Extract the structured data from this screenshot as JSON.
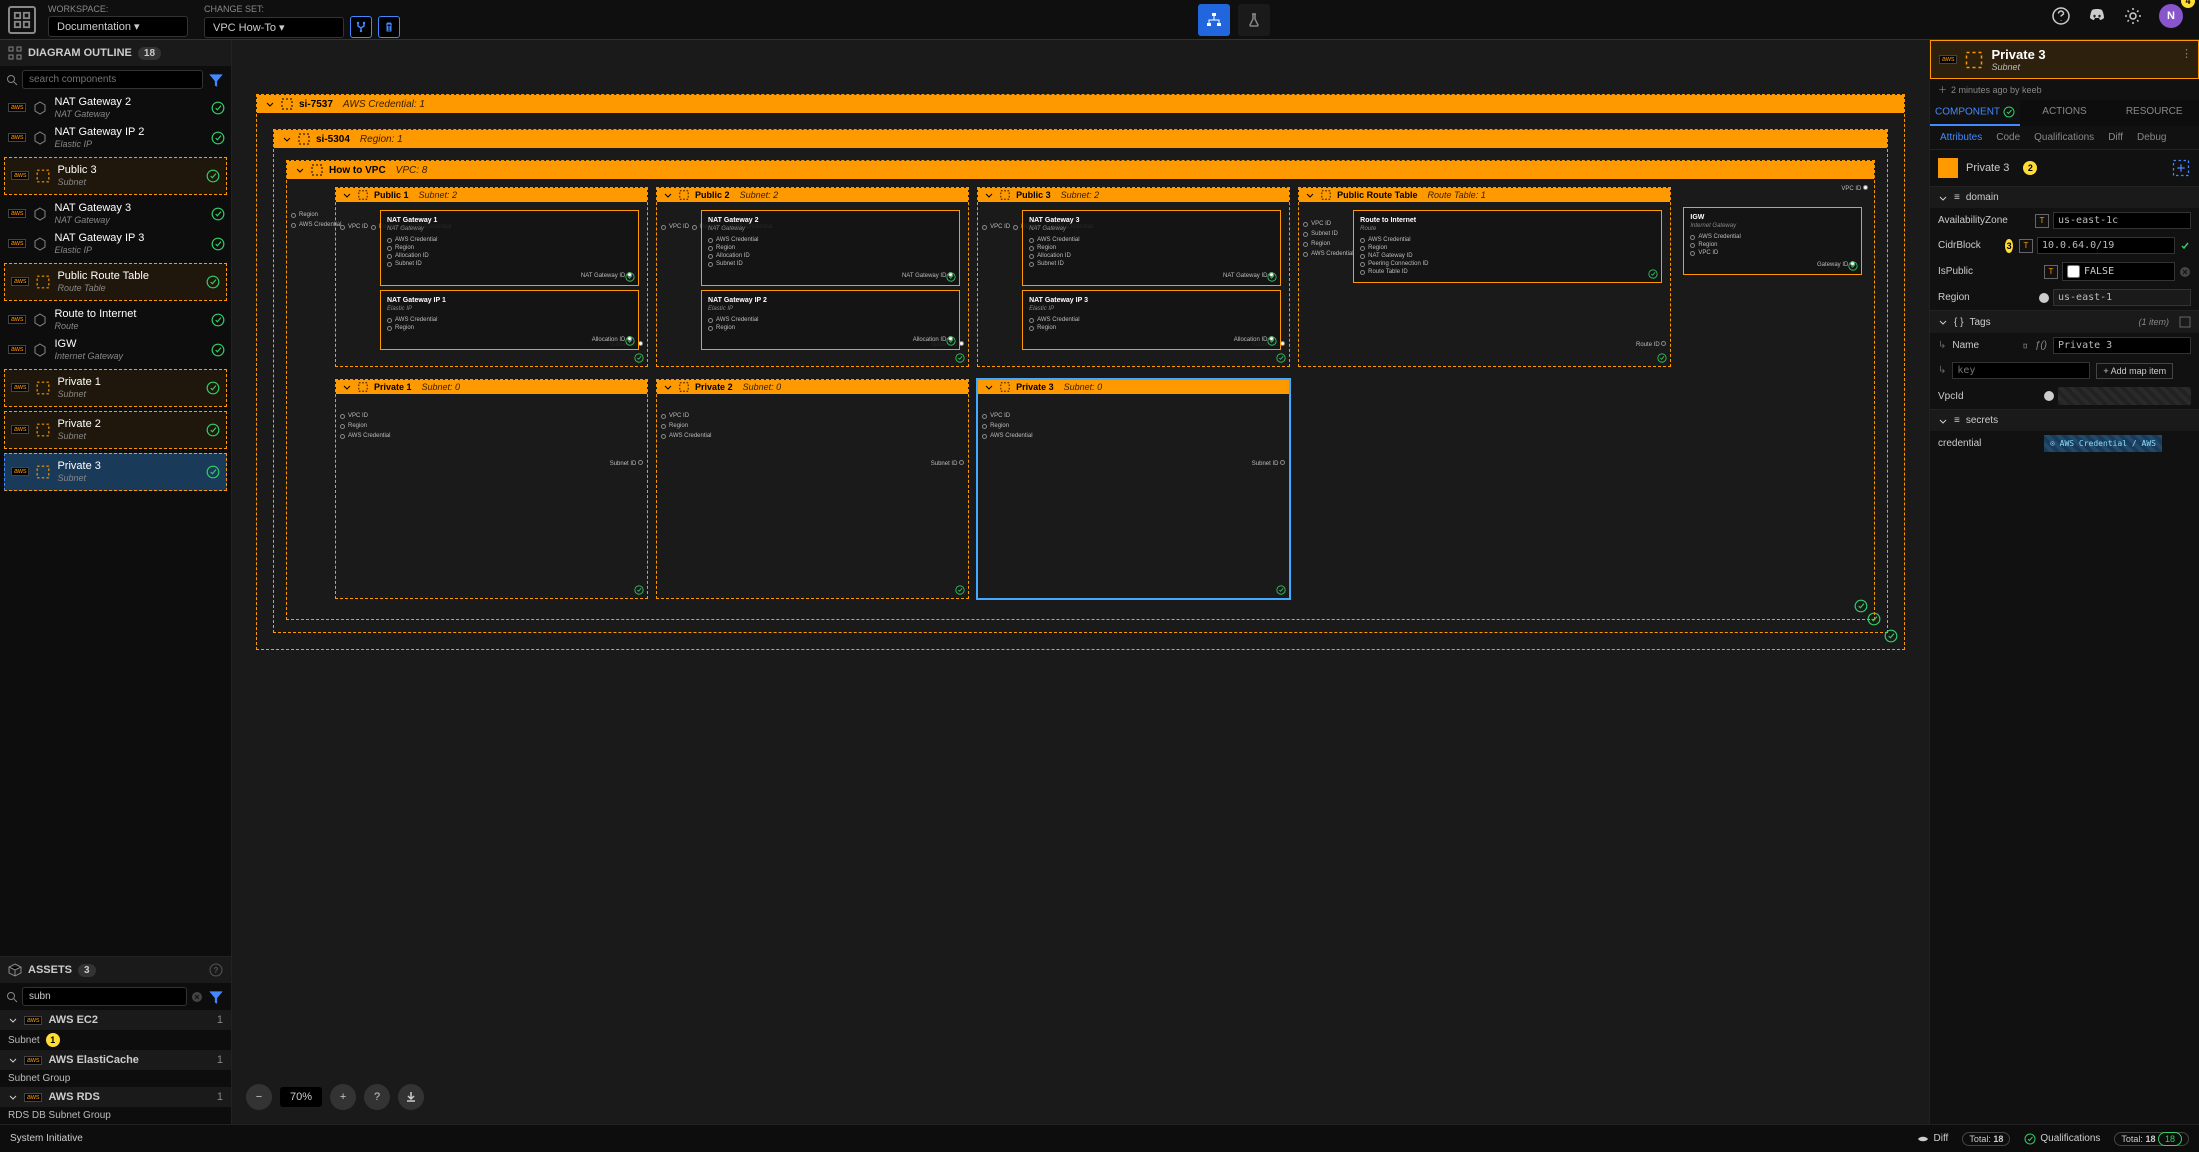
{
  "topbar": {
    "workspace_label": "WORKSPACE:",
    "workspace_value": "Documentation",
    "changeset_label": "CHANGE SET:",
    "changeset_value": "VPC How-To",
    "avatar_initial": "N"
  },
  "outline": {
    "title": "DIAGRAM OUTLINE",
    "count": "18",
    "search_placeholder": "search components",
    "items": [
      {
        "name": "NAT Gateway 2",
        "sub": "NAT Gateway",
        "frame": false
      },
      {
        "name": "NAT Gateway IP 2",
        "sub": "Elastic IP",
        "frame": false
      },
      {
        "name": "Public 3",
        "sub": "Subnet",
        "frame": true
      },
      {
        "name": "NAT Gateway 3",
        "sub": "NAT Gateway",
        "frame": false
      },
      {
        "name": "NAT Gateway IP 3",
        "sub": "Elastic IP",
        "frame": false
      },
      {
        "name": "Public Route Table",
        "sub": "Route Table",
        "frame": true
      },
      {
        "name": "Route to Internet",
        "sub": "Route",
        "frame": false
      },
      {
        "name": "IGW",
        "sub": "Internet Gateway",
        "frame": false
      },
      {
        "name": "Private 1",
        "sub": "Subnet",
        "frame": true
      },
      {
        "name": "Private 2",
        "sub": "Subnet",
        "frame": true
      },
      {
        "name": "Private 3",
        "sub": "Subnet",
        "frame": true,
        "selected": true
      }
    ]
  },
  "assets": {
    "title": "ASSETS",
    "count": "3",
    "search_value": "subn",
    "groups": [
      {
        "name": "AWS EC2",
        "count": "1",
        "children": [
          {
            "name": "Subnet",
            "badge": "1"
          }
        ]
      },
      {
        "name": "AWS ElastiCache",
        "count": "1",
        "children": [
          {
            "name": "Subnet Group"
          }
        ]
      },
      {
        "name": "AWS RDS",
        "count": "1",
        "children": [
          {
            "name": "RDS DB Subnet Group"
          }
        ]
      }
    ]
  },
  "canvas": {
    "zoom": "70%",
    "root": {
      "name": "si-7537",
      "sub": "AWS Credential: 1"
    },
    "region": {
      "name": "si-5304",
      "sub": "Region: 1"
    },
    "vpc": {
      "name": "How to VPC",
      "sub": "VPC: 8"
    },
    "public_subnets": [
      {
        "name": "Public 1",
        "sub": "Subnet: 2",
        "nat": "NAT Gateway 1",
        "nat_ip": "NAT Gateway IP 1"
      },
      {
        "name": "Public 2",
        "sub": "Subnet: 2",
        "nat": "NAT Gateway 2",
        "nat_ip": "NAT Gateway IP 2"
      },
      {
        "name": "Public 3",
        "sub": "Subnet: 2",
        "nat": "NAT Gateway 3",
        "nat_ip": "NAT Gateway IP 3"
      }
    ],
    "route_table": {
      "name": "Public Route Table",
      "sub": "Route Table: 1"
    },
    "route": {
      "name": "Route to Internet",
      "sub": "Route"
    },
    "igw": {
      "name": "IGW",
      "sub": "Internet Gateway"
    },
    "private_subnets": [
      {
        "name": "Private 1",
        "sub": "Subnet: 0"
      },
      {
        "name": "Private 2",
        "sub": "Subnet: 0"
      },
      {
        "name": "Private 3",
        "sub": "Subnet: 0",
        "selected": true
      }
    ],
    "ports": {
      "nat": [
        "AWS Credential",
        "Region",
        "Allocation ID",
        "Subnet ID"
      ],
      "nat_out": "NAT Gateway ID",
      "eip": [
        "AWS Credential",
        "Region"
      ],
      "eip_out": "Allocation ID",
      "subnet_frame": [
        "Region",
        "AWS Credential"
      ],
      "subnet_in": [
        "VPC ID",
        "Region",
        "AWS Credential"
      ],
      "subnet_out": "Subnet ID",
      "route": [
        "AWS Credential",
        "Region",
        "NAT Gateway ID",
        "Peering Connection ID",
        "Route Table ID"
      ],
      "rt_frame": [
        "VPC ID",
        "Subnet ID",
        "Region",
        "AWS Credential"
      ],
      "rt_out": "Route ID",
      "igw": [
        "AWS Credential",
        "Region",
        "VPC ID"
      ],
      "igw_out": "Gateway ID",
      "vpc_out": "VPC ID"
    }
  },
  "right": {
    "title": "Private 3",
    "subtitle": "Subnet",
    "meta": "2 minutes ago by keeb",
    "tabs": [
      "COMPONENT",
      "ACTIONS",
      "RESOURCE"
    ],
    "subtabs": [
      "Attributes",
      "Code",
      "Qualifications",
      "Diff",
      "Debug"
    ],
    "component_name": "Private 3",
    "badges": {
      "b2": "2",
      "b3": "3",
      "b4": "4"
    },
    "domain": {
      "section": "domain",
      "props": {
        "AvailabilityZone": "us-east-1c",
        "CidrBlock": "10.0.64.0/19",
        "IsPublic": "FALSE",
        "Region": "us-east-1"
      }
    },
    "tags": {
      "section": "Tags",
      "meta": "(1 item)",
      "name_key": "Name",
      "name_val": "Private 3",
      "key_placeholder": "key",
      "add_label": "+ Add map item"
    },
    "vpcid_label": "VpcId",
    "secrets": {
      "section": "secrets",
      "cred_label": "credential",
      "cred_val": "⊙ AWS Credential / AWS"
    }
  },
  "footer": {
    "brand": "System Initiative",
    "diff": "Diff",
    "total_label": "Total:",
    "total": "18",
    "qual": "Qualifications",
    "qual_total": "18"
  }
}
